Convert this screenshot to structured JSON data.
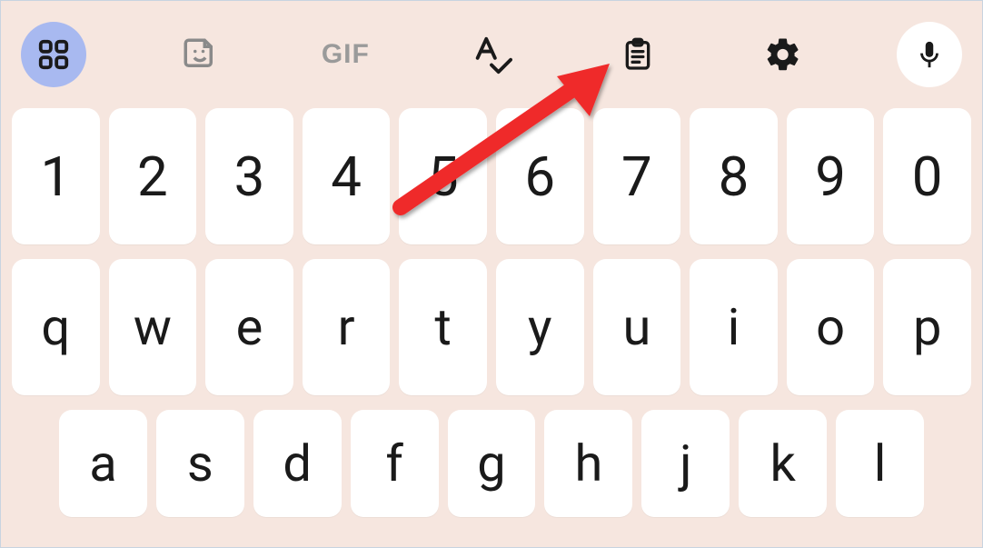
{
  "toolbar": {
    "apps_icon": "apps",
    "sticker_icon": "sticker",
    "gif_label": "GIF",
    "spellcheck_icon": "spellcheck",
    "clipboard_icon": "clipboard",
    "settings_icon": "settings",
    "mic_icon": "mic"
  },
  "rows": {
    "numbers": [
      "1",
      "2",
      "3",
      "4",
      "5",
      "6",
      "7",
      "8",
      "9",
      "0"
    ],
    "letters1": [
      "q",
      "w",
      "e",
      "r",
      "t",
      "y",
      "u",
      "i",
      "o",
      "p"
    ],
    "letters2": [
      "a",
      "s",
      "d",
      "f",
      "g",
      "h",
      "j",
      "k",
      "l"
    ]
  },
  "annotation": {
    "target": "clipboard-button"
  }
}
